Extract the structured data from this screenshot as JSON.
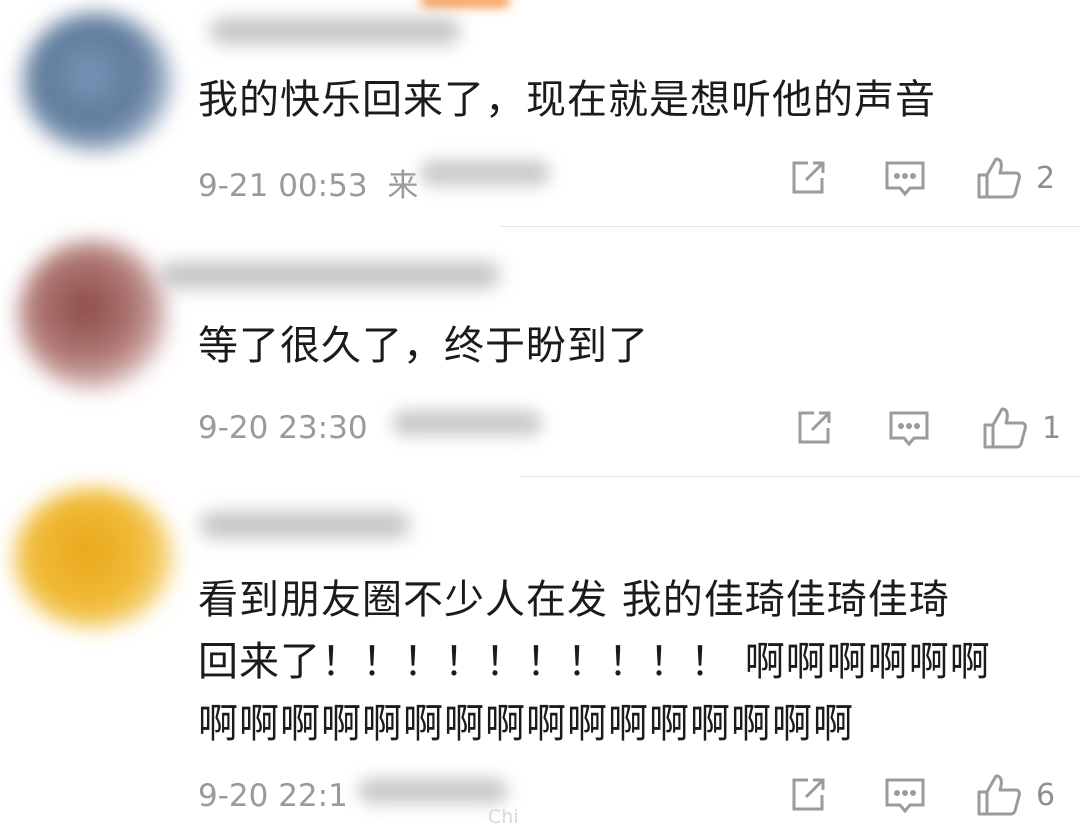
{
  "comments": [
    {
      "text": "我的快乐回来了，现在就是想听他的声音",
      "time": "9-21 00:53",
      "source": "来",
      "likes": "2"
    },
    {
      "text": "等了很久了，终于盼到了",
      "time": "9-20 23:30",
      "source": "",
      "likes": "1"
    },
    {
      "text_lines": [
        "看到朋友圈不少人在发 我的佳琦佳琦佳琦",
        "回来了！！！！！！！！！！ 啊啊啊啊啊啊",
        "啊啊啊啊啊啊啊啊啊啊啊啊啊啊啊啊"
      ],
      "time": "9-20 22:1",
      "source": "",
      "likes": "6"
    }
  ],
  "watermark": "Chi",
  "icons": {
    "share": "share-icon",
    "reply": "comment-icon",
    "like": "thumbs-up-icon"
  },
  "colors": {
    "text": "#1b1b1b",
    "meta": "#9a9a9a",
    "icon": "#9b9b9b"
  }
}
